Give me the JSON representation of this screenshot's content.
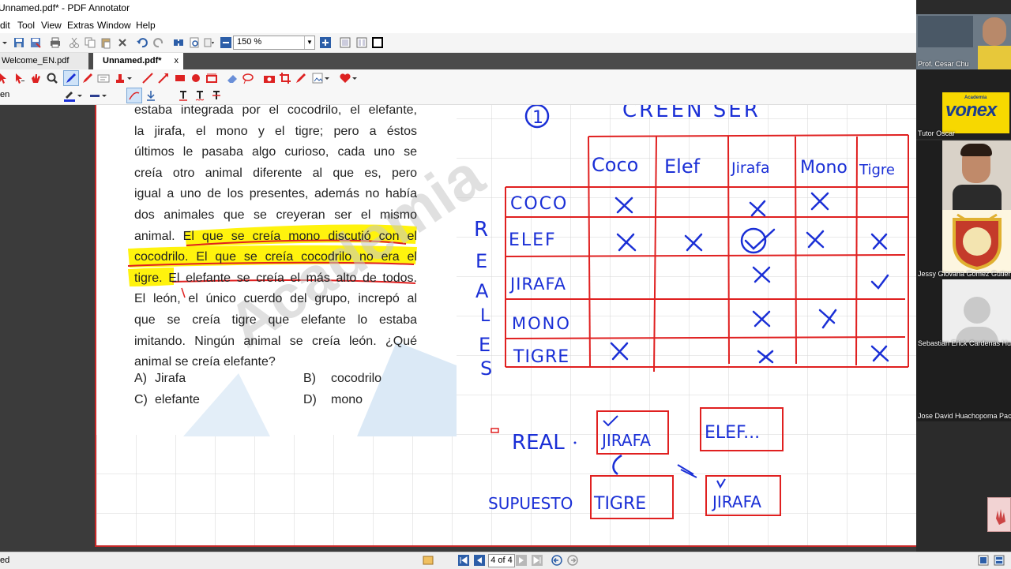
{
  "window": {
    "title": "Unnamed.pdf* - PDF Annotator"
  },
  "menu": [
    "Edit",
    "Tool",
    "View",
    "Extras",
    "Window",
    "Help"
  ],
  "menu_visible": [
    "dit",
    "Tool",
    "View",
    "Extras",
    "Window",
    "Help"
  ],
  "toolbar": {
    "zoom": "150 %"
  },
  "tabs": [
    {
      "label": "Welcome_EN.pdf",
      "active": false
    },
    {
      "label": "Unnamed.pdf*",
      "active": true,
      "close": "x"
    }
  ],
  "anno_toolbar2": {
    "pen_label": "en"
  },
  "question": {
    "lines": [
      "estaba integrada por el cocodrilo, el elefante,",
      "la jirafa, el mono y el tigre; pero a éstos",
      "últimos le pasaba algo curioso, cada uno se",
      "creía otro animal diferente al que es, pero",
      "igual a uno de los presentes, además no había",
      "dos animales que se creyeran ser el mismo",
      "animal. El que se creía mono discutió con el",
      "cocodrilo. El que se creía cocodrilo no era el",
      "tigre. El elefante se creía el más alto de todos.",
      "El león, el único cuerdo del grupo, increpó al",
      "que se creía tigre que elefante lo estaba",
      "imitando. Ningún animal se creía león. ¿Qué",
      "animal se creía elefante?"
    ],
    "options": [
      {
        "letter": "A)",
        "text": "Jirafa"
      },
      {
        "letter": "B)",
        "text": "cocodrilo"
      },
      {
        "letter": "C)",
        "text": "elefante"
      },
      {
        "letter": "D)",
        "text": "mono"
      }
    ],
    "watermark": "Academia"
  },
  "handwriting": {
    "heading_number": "1",
    "heading": "CREEN SER",
    "columns": [
      "Coco",
      "Elef",
      "Jirafa",
      "Mono",
      "Tigre"
    ],
    "rows": [
      "COCO",
      "ELEF",
      "JIRAFA",
      "MONO",
      "TIGRE"
    ],
    "side_label": [
      "R",
      "E",
      "A",
      "L",
      "E",
      "S"
    ],
    "real_label": "REAL",
    "real_box1": "JIRAFA",
    "real_box2": "ELEF...",
    "supuesto_label": "SUPUESTO",
    "supuesto_box1": "TIGRE",
    "supuesto_box2": "JIRAFA"
  },
  "statusbar": {
    "left": "ed",
    "page": "4 of 4"
  },
  "participants": [
    {
      "name": "Prof. Cesar Chu"
    },
    {
      "name": "Tutor Oscar",
      "logo_small": "Academia",
      "logo": "vonex"
    },
    {
      "name": ""
    },
    {
      "name": "Jessy Giovana Gomez Gutierr"
    },
    {
      "name": "Sebastian Erick Cardenas Hu"
    },
    {
      "name": "Jose David Huachopoma Pac"
    }
  ],
  "colors": {
    "pen_blue": "#1a2fd6",
    "pen_red": "#e02020",
    "highlight": "#fff200",
    "accent": "#c62828"
  }
}
